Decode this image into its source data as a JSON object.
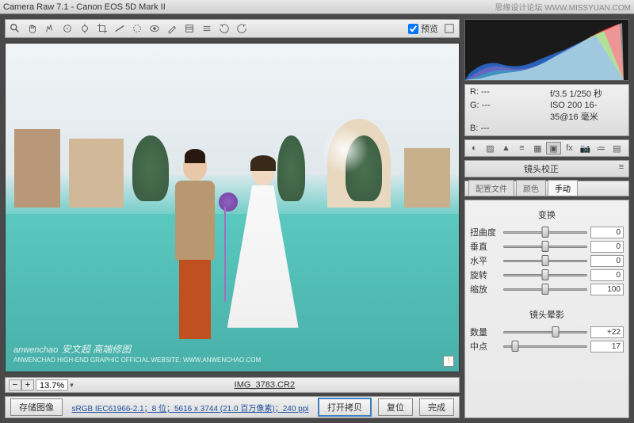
{
  "title": "Camera Raw 7.1  -  Canon EOS 5D Mark II",
  "watermark_site": "思缘设计论坛  WWW.MISSYUAN.COM",
  "preview_label": "预览",
  "zoom": {
    "value": "13.7%"
  },
  "filename": "IMG_3783.CR2",
  "footer": {
    "save_image": "存储图像",
    "metadata": "sRGB IEC61966-2.1；8 位；5616 x 3744 (21.0 百万像素)；240 ppi",
    "open_copy": "打开拷贝",
    "reset": "复位",
    "done": "完成"
  },
  "info": {
    "r": "R:  ---",
    "g": "G:  ---",
    "b": "B:  ---",
    "aperture": "f/3.5   1/250 秒",
    "iso": "ISO 200   16-35@16 毫米"
  },
  "section_title": "镜头校正",
  "sub_tabs": [
    "配置文件",
    "颜色",
    "手动"
  ],
  "active_sub_tab": 2,
  "groups": [
    {
      "label": "变换",
      "sliders": [
        {
          "name": "扭曲度",
          "value": "0",
          "pos": 50
        },
        {
          "name": "垂直",
          "value": "0",
          "pos": 50
        },
        {
          "name": "水平",
          "value": "0",
          "pos": 50
        },
        {
          "name": "旋转",
          "value": "0",
          "pos": 50
        },
        {
          "name": "缩放",
          "value": "100",
          "pos": 50
        }
      ]
    },
    {
      "label": "镜头晕影",
      "sliders": [
        {
          "name": "数量",
          "value": "+22",
          "pos": 62
        },
        {
          "name": "中点",
          "value": "17",
          "pos": 14
        }
      ]
    }
  ],
  "watermark": {
    "main": "anwenchao",
    "sub": "安文超 高端修图",
    "line": "ANWENCHAO HIGH-END GRAPHIC OFFICIAL WEBSITE: WWW.ANWENCHAO.COM"
  }
}
